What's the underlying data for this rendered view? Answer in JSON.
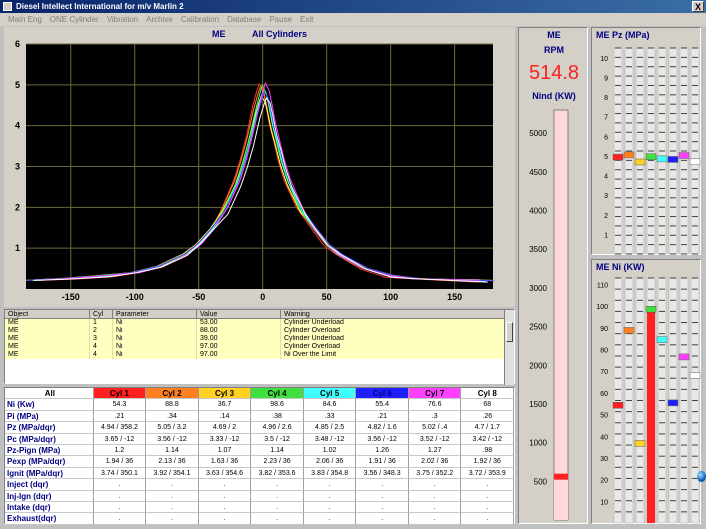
{
  "window": {
    "title": "Diesel Intellect International for m/v Marlin 2",
    "close_label": "X"
  },
  "menu": [
    "Main Eng",
    "ONE Cylinder",
    "Vibration",
    "Archive",
    "Calibration",
    "Database",
    "Pause",
    "Exit"
  ],
  "chart": {
    "title_left": "ME",
    "title_right": "All Cylinders",
    "chart_data": {
      "type": "line",
      "title": "ME   All Cylinders",
      "xlabel": "",
      "ylabel": "",
      "xlim": [
        -185,
        180
      ],
      "ylim": [
        0,
        6
      ],
      "xticks": [
        -150,
        -100,
        -50,
        0,
        50,
        100,
        150
      ],
      "yticks": [
        1,
        2,
        3,
        4,
        5,
        6
      ],
      "grid": true,
      "background": "#000000",
      "series": [
        {
          "color": "#ff3030",
          "peak": 5.05,
          "x": [
            -180,
            -150,
            -120,
            -100,
            -80,
            -60,
            -50,
            -40,
            -30,
            -20,
            -15,
            -10,
            -5,
            -2,
            0,
            3,
            5,
            8,
            12,
            15,
            20,
            30,
            40,
            50,
            60,
            80,
            100,
            120,
            150,
            175
          ],
          "y": [
            0.21,
            0.26,
            0.33,
            0.4,
            0.55,
            0.85,
            1.1,
            1.45,
            2.0,
            2.7,
            3.2,
            3.8,
            4.5,
            4.85,
            5.05,
            4.9,
            4.6,
            4.1,
            3.6,
            3.2,
            2.7,
            2.0,
            1.5,
            1.1,
            0.85,
            0.5,
            0.32,
            0.25,
            0.22,
            0.2
          ]
        },
        {
          "color": "#ff8020",
          "peak": 4.95
        },
        {
          "color": "#ffff40",
          "peak": 4.72
        },
        {
          "color": "#40ff40",
          "peak": 4.96
        },
        {
          "color": "#40ffff",
          "peak": 4.88
        },
        {
          "color": "#4040ff",
          "peak": 4.82
        },
        {
          "color": "#ff40ff",
          "peak": 5.02
        },
        {
          "color": "#ffffff",
          "peak": 4.7
        }
      ]
    }
  },
  "warnings": {
    "columns": [
      "Object",
      "Cyl",
      "Parameter",
      "Value",
      "Warning"
    ],
    "rows": [
      [
        "ME",
        "1",
        "Ni",
        "53.00",
        "Cylinder Underload"
      ],
      [
        "ME",
        "2",
        "Ni",
        "88.00",
        "Cylinder Overload"
      ],
      [
        "ME",
        "3",
        "Ni",
        "39.00",
        "Cylinder Underload"
      ],
      [
        "ME",
        "4",
        "Ni",
        "97.00",
        "Cylinder Overload"
      ],
      [
        "ME",
        "4",
        "Ni",
        "97.00",
        "Ni Over the Limit"
      ]
    ]
  },
  "table": {
    "corner": "All",
    "cylinders": [
      {
        "label": "Cyl 1",
        "color": "#ff2020"
      },
      {
        "label": "Cyl 2",
        "color": "#ff8020"
      },
      {
        "label": "Cyl 3",
        "color": "#ffd020"
      },
      {
        "label": "Cyl 4",
        "color": "#40e040"
      },
      {
        "label": "Cyl 5",
        "color": "#40ffff"
      },
      {
        "label": "Cyl 6",
        "color": "#2020ff"
      },
      {
        "label": "Cyl 7",
        "color": "#ff40ff"
      },
      {
        "label": "Cyl 8",
        "color": "#ffffff"
      }
    ],
    "rows": [
      {
        "label": "Ni     (Kw)",
        "values": [
          "54.3",
          "88.8",
          "36.7",
          "98.6",
          "84.6",
          "55.4",
          "76.6",
          "68"
        ]
      },
      {
        "label": "Pi      (MPa)",
        "values": [
          ".21",
          ".34",
          ".14",
          ".38",
          ".33",
          ".21",
          ".3",
          ".26"
        ]
      },
      {
        "label": "Pz     (MPa/dqr)",
        "values": [
          "4.94 / 358.2",
          "5.05 / 3.2",
          "4.69 / 2",
          "4.96 / 2.6",
          "4.85 / 2.5",
          "4.82 / 1.6",
          "5.02 / .4",
          "4.7 / 1.7"
        ]
      },
      {
        "label": "Pc     (MPa/dqr)",
        "values": [
          "3.65 / -12",
          "3.56 / -12",
          "3.33 / -12",
          "3.5 / -12",
          "3.48 / -12",
          "3.56 / -12",
          "3.52 / -12",
          "3.42 / -12"
        ]
      },
      {
        "label": "Pz-Pign   (MPa)",
        "values": [
          "1.2",
          "1.14",
          "1.07",
          "1.14",
          "1.02",
          "1.26",
          "1.27",
          ".98"
        ]
      },
      {
        "label": "Pexp   (MPa/dqr)",
        "values": [
          "1.94 / 36",
          "2.13 / 36",
          "1.63 / 36",
          "2.23 / 36",
          "2.06 / 36",
          "1.91 / 36",
          "2.02 / 36",
          "1.92 / 36"
        ]
      },
      {
        "label": "Ignit  (MPa/dqr)",
        "values": [
          "3.74 / 350.1",
          "3.92 / 354.1",
          "3.63 / 354.6",
          "3.82 / 353.6",
          "3.83 / 354.8",
          "3.56 / 348.3",
          "3.75 / 352.2",
          "3.72 / 353.9"
        ]
      },
      {
        "label": "Inject (dqr)",
        "values": [
          ".",
          ".",
          ".",
          ".",
          ".",
          ".",
          ".",
          "."
        ]
      },
      {
        "label": "Inj-Ign  (dqr)",
        "values": [
          ".",
          ".",
          ".",
          ".",
          ".",
          ".",
          ".",
          "."
        ]
      },
      {
        "label": "Intake (dqr)",
        "values": [
          ".",
          ".",
          ".",
          ".",
          ".",
          ".",
          ".",
          "."
        ]
      },
      {
        "label": "Exhaust(dqr)",
        "values": [
          ".",
          ".",
          ".",
          ".",
          ".",
          ".",
          ".",
          "."
        ]
      }
    ]
  },
  "rpm_panel": {
    "title": "ME",
    "rpm_label": "RPM",
    "rpm_value": "514.8",
    "nind_label": "Nind (KW)",
    "scale": [
      "5000",
      "4500",
      "4000",
      "3500",
      "3000",
      "2500",
      "2000",
      "1500",
      "1000",
      "500"
    ],
    "nind_value": 560,
    "nind_max": 5300,
    "bar_color": "#ff2020"
  },
  "pz_panel": {
    "title": "ME Pz  (MPa)",
    "scale": [
      "10",
      "9",
      "8",
      "7",
      "6",
      "5",
      "4",
      "3",
      "2",
      "1"
    ],
    "max": 10.5,
    "markers": [
      {
        "value": 4.94,
        "color": "#ff2020"
      },
      {
        "value": 5.05,
        "color": "#ff8020"
      },
      {
        "value": 4.69,
        "color": "#ffd020"
      },
      {
        "value": 4.96,
        "color": "#40e040"
      },
      {
        "value": 4.85,
        "color": "#40ffff"
      },
      {
        "value": 4.82,
        "color": "#2020ff"
      },
      {
        "value": 5.02,
        "color": "#ff40ff"
      },
      {
        "value": 4.7,
        "color": "#ffffff"
      }
    ]
  },
  "ni_panel": {
    "title": "ME Ni  (KW)",
    "scale": [
      "110",
      "100",
      "90",
      "80",
      "70",
      "60",
      "50",
      "40",
      "30",
      "20",
      "10"
    ],
    "max": 113,
    "markers": [
      {
        "value": 54.3,
        "color": "#ff2020"
      },
      {
        "value": 88.8,
        "color": "#ff8020"
      },
      {
        "value": 36.7,
        "color": "#ffd020"
      },
      {
        "value": 98.6,
        "color": "#40e040",
        "fill": "#ff2020"
      },
      {
        "value": 84.6,
        "color": "#40ffff"
      },
      {
        "value": 55.4,
        "color": "#2020ff"
      },
      {
        "value": 76.6,
        "color": "#ff40ff"
      },
      {
        "value": 68,
        "color": "#ffffff"
      }
    ]
  }
}
